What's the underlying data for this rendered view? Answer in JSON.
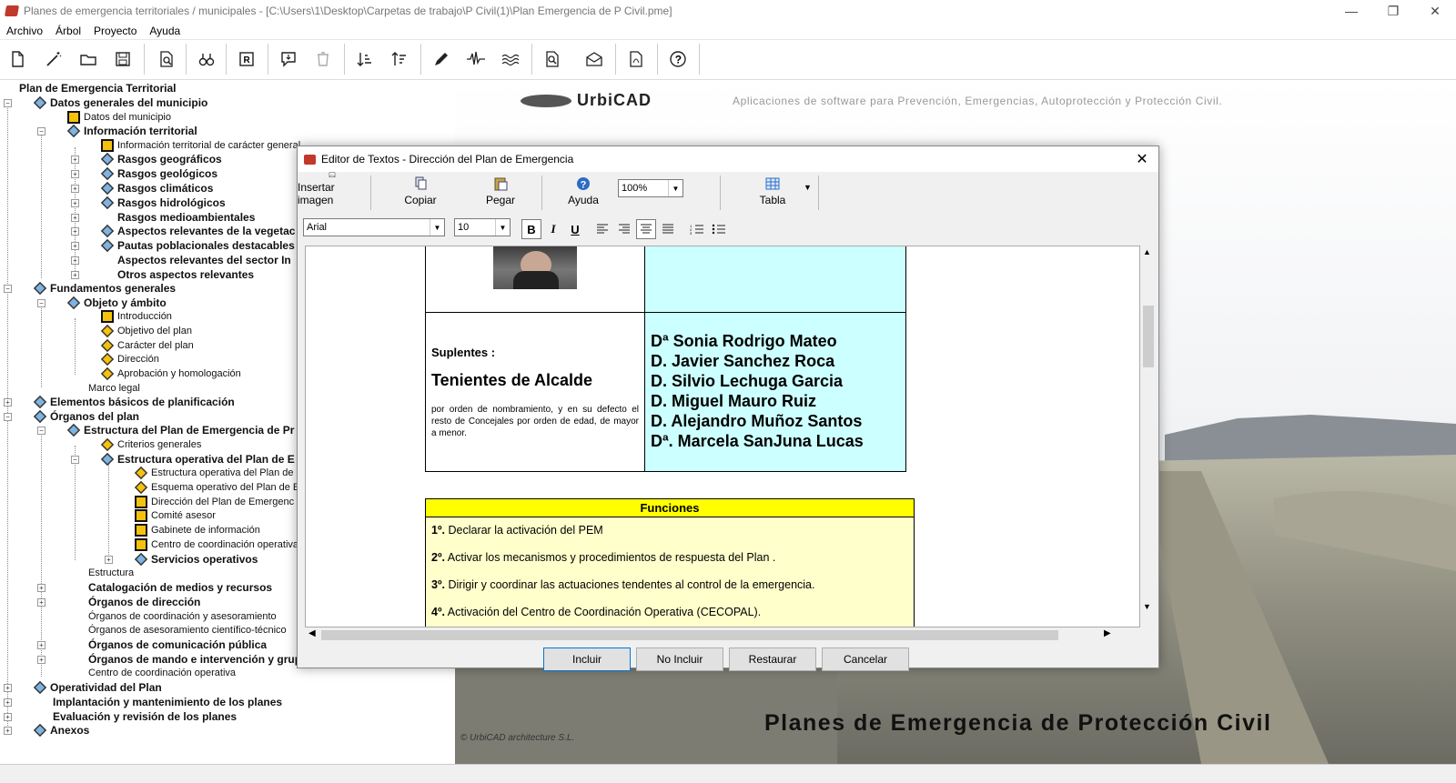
{
  "window": {
    "title": "Planes de emergencia territoriales / municipales - [C:\\Users\\1\\Desktop\\Carpetas de trabajo\\P Civil(1)\\Plan Emergencia de P Civil.pme]"
  },
  "menu": [
    "Archivo",
    "Árbol",
    "Proyecto",
    "Ayuda"
  ],
  "tree": {
    "root": "Plan de Emergencia Territorial",
    "items": [
      "Datos generales del municipio",
      "Datos del municipio",
      "Información territorial",
      "Información territorial de carácter general",
      "Rasgos geográficos",
      "Rasgos geológicos",
      "Rasgos climáticos",
      "Rasgos hidrológicos",
      "Rasgos medioambientales",
      "Aspectos relevantes de la vegetac",
      "Pautas poblacionales destacables",
      "Aspectos relevantes del sector In",
      "Otros aspectos relevantes",
      "Fundamentos generales",
      "Objeto y ámbito",
      "Introducción",
      "Objetivo del plan",
      "Carácter del plan",
      "Dirección",
      "Aprobación y homologación",
      "Marco legal",
      "Elementos básicos de planificación",
      "Órganos del plan",
      "Estructura del Plan de Emergencia de Pr",
      "Criterios generales",
      "Estructura operativa del Plan de E",
      "Estructura operativa del Plan de",
      "Esquema operativo del Plan de E",
      "Dirección del Plan de Emergenc",
      "Comité asesor",
      "Gabinete de información",
      "Centro de coordinación operativa",
      "Servicios operativos",
      "Estructura",
      "Catalogación de medios y recursos",
      "Órganos de dirección",
      "Órganos de coordinación y asesoramiento",
      "Órganos de asesoramiento científico-técnico",
      "Órganos de comunicación pública",
      "Órganos de mando e intervención y grupos de acción",
      "Centro de coordinación operativa",
      "Operatividad del Plan",
      "Implantación y mantenimiento de los planes",
      "Evaluación y revisión de los planes",
      "Anexos"
    ]
  },
  "brand": {
    "logo_text": "UrbiCAD",
    "tagline": "Aplicaciones de software para Prevención, Emergencias, Autoprotección y Protección Civil.",
    "title": "Planes de Emergencia de Protección Civil",
    "credits": "© UrbiCAD architecture S.L."
  },
  "dialog": {
    "title": "Editor de Textos - Dirección del Plan de Emergencia",
    "toolbar": {
      "insert_image": "Insertar imagen",
      "copy": "Copiar",
      "paste": "Pegar",
      "help": "Ayuda",
      "zoom": "100%",
      "table": "Tabla"
    },
    "font": {
      "name": "Arial",
      "size": "10"
    },
    "content": {
      "suplentes": "Suplentes :",
      "tenientes": "Tenientes de Alcalde",
      "nota": "por orden de nombramiento, y en su defecto el resto de Concejales por orden de edad, de mayor a menor.",
      "names": [
        "Dª Sonia Rodrigo Mateo",
        "D. Javier Sanchez Roca",
        "D. Silvio Lechuga Garcia",
        "D. Miguel Mauro Ruiz",
        "D. Alejandro Muñoz Santos",
        "Dª. Marcela SanJuna Lucas"
      ],
      "funciones_header": "Funciones",
      "funciones": [
        {
          "n": "1º.",
          "t": "Declarar la activación del PEM"
        },
        {
          "n": "2º.",
          "t": "Activar los mecanismos y procedimientos de respuesta del Plan ."
        },
        {
          "n": "3º.",
          "t": "Dirigir y coordinar las actuaciones tendentes al control de la emergencia."
        },
        {
          "n": "4º.",
          "t": "Activación del Centro de Coordinación Operativa (CECOPAL)."
        }
      ]
    },
    "buttons": {
      "include": "Incluir",
      "exclude": "No Incluir",
      "restore": "Restaurar",
      "cancel": "Cancelar"
    }
  }
}
